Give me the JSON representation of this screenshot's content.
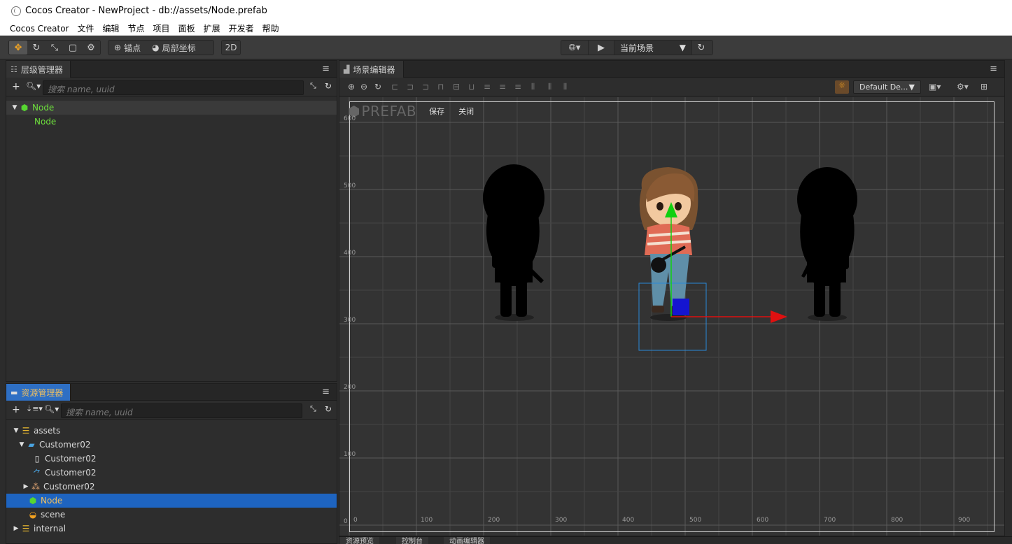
{
  "window": {
    "title": "Cocos Creator - NewProject - db://assets/Node.prefab"
  },
  "menu": [
    "Cocos Creator",
    "文件",
    "编辑",
    "节点",
    "项目",
    "面板",
    "扩展",
    "开发者",
    "帮助"
  ],
  "toolbar": {
    "anchor_label": "锚点",
    "local_coords_label": "局部坐标",
    "mode_2d_label": "2D",
    "scene_select_value": "当前场景"
  },
  "hierarchy": {
    "title": "层级管理器",
    "search_placeholder": "搜索 name, uuid",
    "items": [
      {
        "label": "Node",
        "depth": 0,
        "expanded": true
      },
      {
        "label": "Node",
        "depth": 1
      }
    ]
  },
  "assets": {
    "title": "资源管理器",
    "search_placeholder": "搜索 name, uuid",
    "items": [
      {
        "label": "assets",
        "depth": 0,
        "arrow": "down",
        "icon": "database-icon"
      },
      {
        "label": "Customer02",
        "depth": 1,
        "arrow": "down",
        "icon": "folder-icon"
      },
      {
        "label": "Customer02",
        "depth": 2,
        "arrow": "",
        "icon": "file-icon"
      },
      {
        "label": "Customer02",
        "depth": 2,
        "arrow": "",
        "icon": "skeleton-icon"
      },
      {
        "label": "Customer02",
        "depth": 2,
        "arrow": "right",
        "icon": "atlas-icon"
      },
      {
        "label": "Node",
        "depth": 1,
        "arrow": "",
        "icon": "prefab-icon",
        "selected": true
      },
      {
        "label": "scene",
        "depth": 1,
        "arrow": "",
        "icon": "scene-icon"
      },
      {
        "label": "internal",
        "depth": 0,
        "arrow": "right",
        "icon": "database-icon"
      }
    ]
  },
  "scene_editor": {
    "title": "场景编辑器",
    "layout_value": "Default De...",
    "prefab_label": "PREFAB",
    "save_label": "保存",
    "close_label": "关闭",
    "x_ticks": [
      "0",
      "100",
      "200",
      "300",
      "400",
      "500",
      "600",
      "700",
      "800",
      "900"
    ],
    "y_ticks": [
      "0",
      "100",
      "200",
      "300",
      "400",
      "500",
      "600"
    ]
  },
  "bottom_tabs": [
    "资源预览",
    "控制台",
    "动画编辑器"
  ],
  "colors": {
    "accent_blue": "#1e64c0",
    "node_green": "#57d631",
    "gizmo_red": "#e01010",
    "gizmo_green": "#10d010"
  }
}
